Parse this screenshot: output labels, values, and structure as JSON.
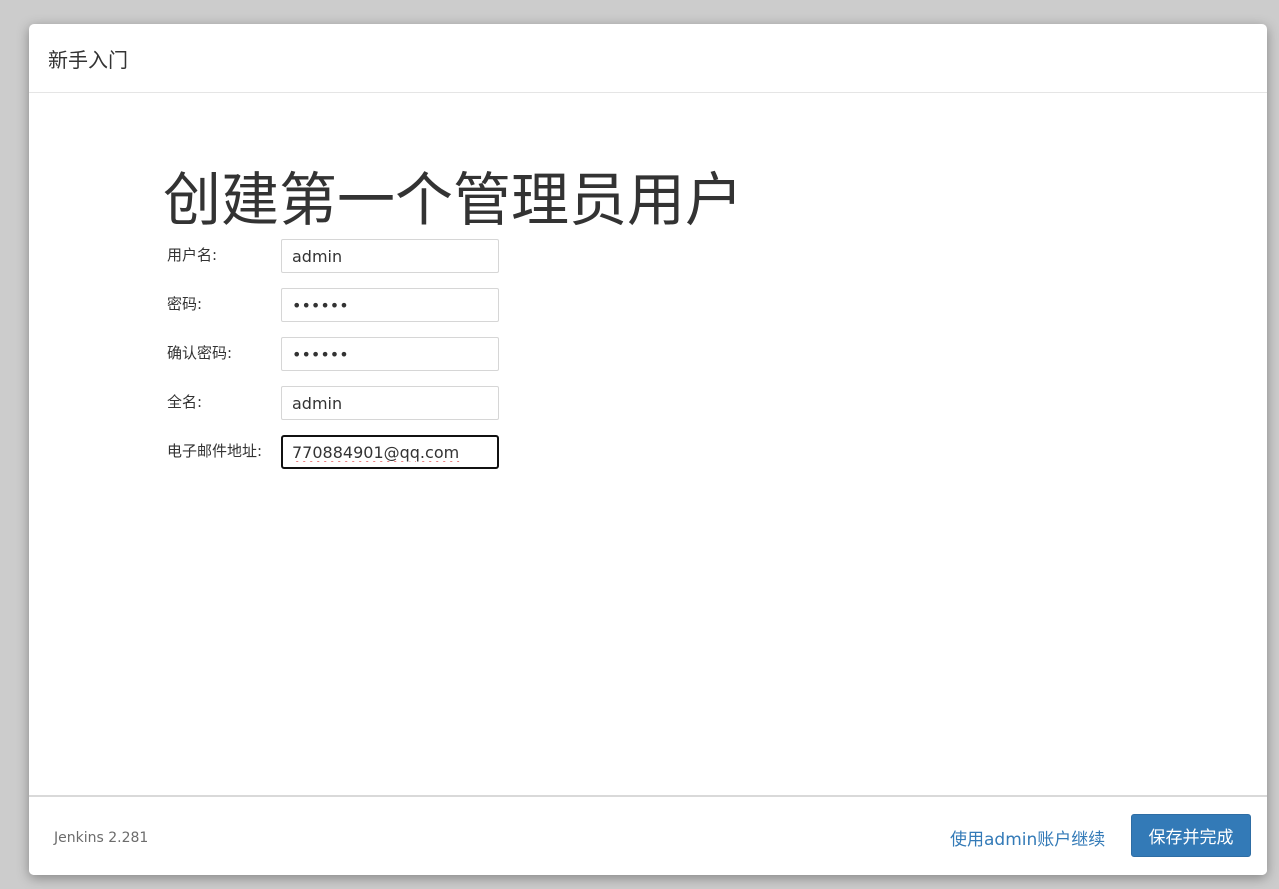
{
  "dialog": {
    "title": "新手入门",
    "heading": "创建第一个管理员用户"
  },
  "form": {
    "fields": [
      {
        "label": "用户名:",
        "value": "admin",
        "type": "text"
      },
      {
        "label": "密码:",
        "value": "••••••",
        "type": "password"
      },
      {
        "label": "确认密码:",
        "value": "••••••",
        "type": "password"
      },
      {
        "label": "全名:",
        "value": "admin",
        "type": "text"
      },
      {
        "label": "电子邮件地址:",
        "value": "770884901@qq.com",
        "type": "email"
      }
    ]
  },
  "footer": {
    "version": "Jenkins 2.281",
    "continue_link": "使用admin账户继续",
    "save_button": "保存并完成"
  },
  "colors": {
    "primary": "#337ab7",
    "backdrop": "#cccccc"
  }
}
